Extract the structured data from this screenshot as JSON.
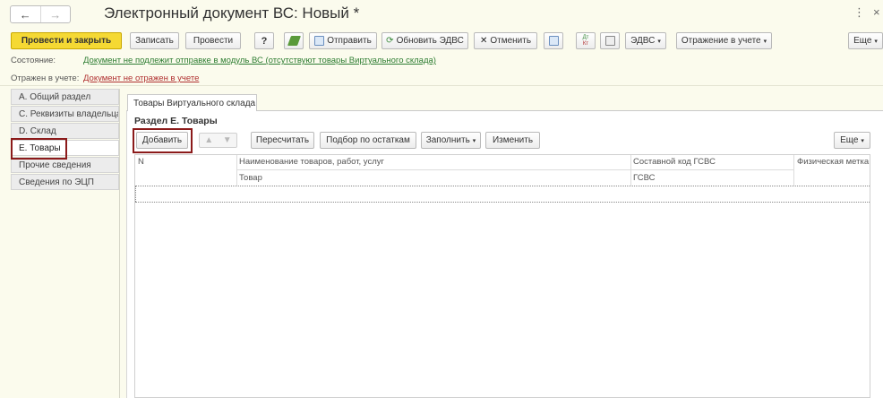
{
  "window": {
    "title": "Электронный документ ВС: Новый *",
    "back_icon": "arrow-left-icon",
    "forward_icon": "arrow-right-icon",
    "more_glyph": "⋮",
    "close_glyph": "×"
  },
  "toolbar": {
    "post_close": "Провести и закрыть",
    "save": "Записать",
    "post": "Провести",
    "help": "?",
    "send": "Отправить",
    "refresh_edvs": "Обновить ЭДВС",
    "cancel": "Отменить",
    "edvs": "ЭДВС",
    "reflection": "Отражение в учете",
    "more": "Еще",
    "dt_kt_top": "Дт",
    "dt_kt_bottom": "Кт"
  },
  "status": {
    "state_label": "Состояние:",
    "state_value": "Документ не подлежит отправке в модуль ВС (отсутствуют товары Виртуального склада)",
    "reflected_label": "Отражен в учете:",
    "reflected_value": "Документ не отражен в учете"
  },
  "sidebar": {
    "items": [
      {
        "label": "А. Общий раздел"
      },
      {
        "label": "С. Реквизиты владельца"
      },
      {
        "label": "D. Склад"
      },
      {
        "label": "Е. Товары"
      },
      {
        "label": "Прочие сведения"
      },
      {
        "label": "Сведения по ЭЦП"
      }
    ]
  },
  "main": {
    "tab": "Товары Виртуального склада",
    "section_title": "Раздел Е. Товары",
    "buttons": {
      "add": "Добавить",
      "recalc": "Пересчитать",
      "pick": "Подбор по остаткам",
      "fill": "Заполнить",
      "change": "Изменить",
      "more": "Еще"
    },
    "grid": {
      "columns": [
        "N",
        "Наименование товаров, работ, услуг",
        "Составной код ГСВС",
        "Физическая метка"
      ],
      "subheaders": [
        "",
        "Товар",
        "ГСВС",
        ""
      ]
    }
  },
  "colors": {
    "background": "#fbfbed",
    "primary_button": "#f5d933",
    "highlight_border": "#8b1a1a",
    "link_green": "#2e7d32",
    "link_red": "#b03030"
  }
}
